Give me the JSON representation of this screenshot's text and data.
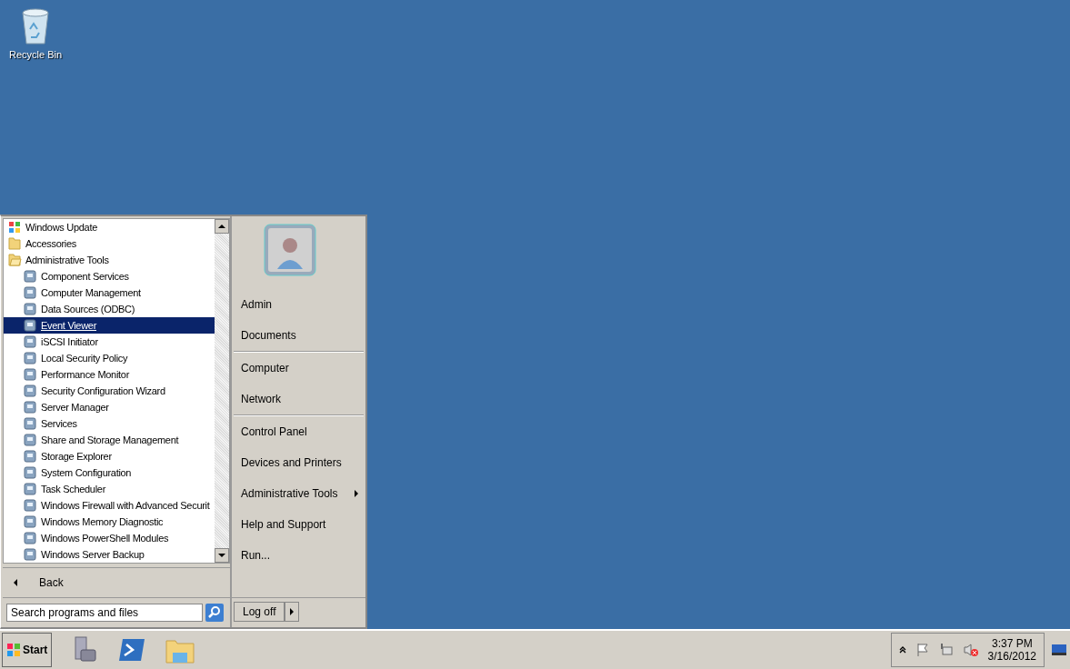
{
  "desktop_icons": [
    {
      "label": "Recycle Bin"
    }
  ],
  "start_menu": {
    "programs": [
      {
        "label": "Windows Update",
        "kind": "app",
        "selected": false
      },
      {
        "label": "Accessories",
        "kind": "folder",
        "selected": false,
        "expanded": false
      },
      {
        "label": "Administrative Tools",
        "kind": "folder",
        "selected": false,
        "expanded": true,
        "children": [
          {
            "label": "Component Services",
            "selected": false
          },
          {
            "label": "Computer Management",
            "selected": false
          },
          {
            "label": "Data Sources (ODBC)",
            "selected": false
          },
          {
            "label": "Event Viewer",
            "selected": true
          },
          {
            "label": "iSCSI Initiator",
            "selected": false
          },
          {
            "label": "Local Security Policy",
            "selected": false
          },
          {
            "label": "Performance Monitor",
            "selected": false
          },
          {
            "label": "Security Configuration Wizard",
            "selected": false
          },
          {
            "label": "Server Manager",
            "selected": false
          },
          {
            "label": "Services",
            "selected": false
          },
          {
            "label": "Share and Storage Management",
            "selected": false
          },
          {
            "label": "Storage Explorer",
            "selected": false
          },
          {
            "label": "System Configuration",
            "selected": false
          },
          {
            "label": "Task Scheduler",
            "selected": false
          },
          {
            "label": "Windows Firewall with Advanced Securit",
            "selected": false
          },
          {
            "label": "Windows Memory Diagnostic",
            "selected": false
          },
          {
            "label": "Windows PowerShell Modules",
            "selected": false
          },
          {
            "label": "Windows Server Backup",
            "selected": false
          }
        ]
      }
    ],
    "back": "Back",
    "search": {
      "placeholder": "Search programs and files"
    },
    "places": [
      [
        {
          "label": "Admin",
          "has_submenu": false
        },
        {
          "label": "Documents",
          "has_submenu": false
        }
      ],
      [
        {
          "label": "Computer",
          "has_submenu": false
        },
        {
          "label": "Network",
          "has_submenu": false
        }
      ],
      [
        {
          "label": "Control Panel",
          "has_submenu": false
        },
        {
          "label": "Devices and Printers",
          "has_submenu": false
        },
        {
          "label": "Administrative Tools",
          "has_submenu": true
        },
        {
          "label": "Help and Support",
          "has_submenu": false
        },
        {
          "label": "Run...",
          "has_submenu": false
        }
      ]
    ],
    "log_off": "Log off"
  },
  "taskbar": {
    "start": "Start",
    "clock": {
      "time": "3:37 PM",
      "date": "3/16/2012"
    }
  }
}
